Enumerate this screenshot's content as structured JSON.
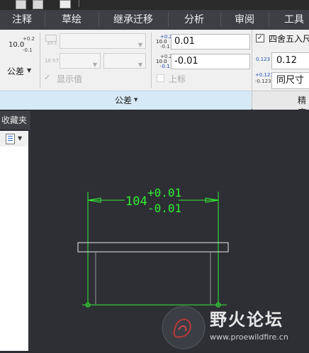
{
  "tabs": [
    {
      "label": "注释"
    },
    {
      "label": "草绘"
    },
    {
      "label": "继承迁移"
    },
    {
      "label": "分析"
    },
    {
      "label": "审阅"
    },
    {
      "label": "工具"
    }
  ],
  "tolerance_group": {
    "button_icon_base": "10.0",
    "button_icon_upper": "+0.2",
    "button_icon_lower": "-0.1",
    "button_label": "公差",
    "limits_icon_label": "±0.1",
    "fit_icon_label": "10 h7",
    "show_value_label": "显示值",
    "upper_icon_base": "10.0",
    "upper_icon_top": "+0.2",
    "upper_icon_bottom": "-0.1",
    "upper_value": "0.01",
    "lower_icon_base": "10.0",
    "lower_icon_top": "+0.2",
    "lower_icon_bottom": "-0.1",
    "lower_value": "-0.01",
    "superscript_label": "上标",
    "group_title": "公差"
  },
  "precision_group": {
    "rounding_label": "四舍五入尺寸",
    "rounding_checked": true,
    "decimal_icon": "0.123",
    "decimal_value": "0.12",
    "tolerance_icon_top": "+0.123",
    "tolerance_icon_bottom": "-0.123",
    "tolerance_value": "同尺寸",
    "group_title": "精度"
  },
  "left_panel": {
    "title": "收藏夹"
  },
  "dimension": {
    "nominal": "104",
    "upper": "+0.01",
    "lower": "-0.01",
    "color": "#33ee33"
  },
  "watermark": {
    "text": "野火论坛",
    "url": "www.proewildfire.cn"
  },
  "colors": {
    "tab_bar": "#3d3f44",
    "ribbon": "#f0f0f0",
    "group_footer": "#d6e9f7",
    "canvas": "#2d2f35",
    "dimension": "#33ee33"
  }
}
